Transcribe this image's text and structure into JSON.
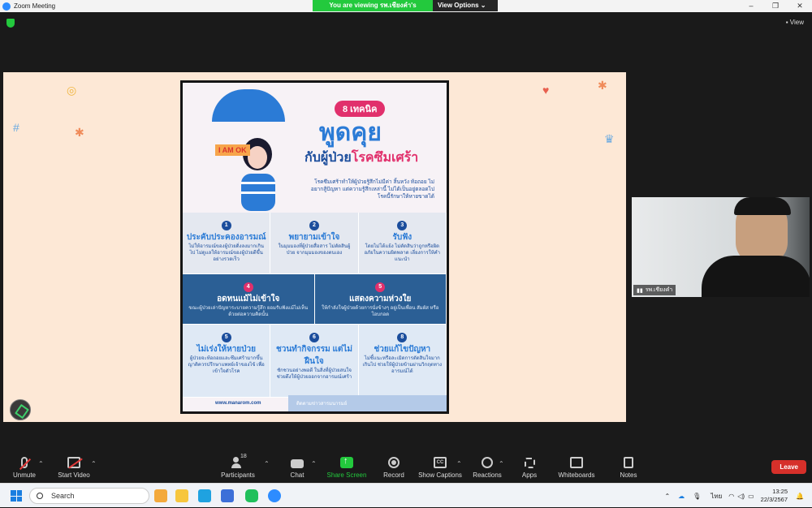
{
  "window": {
    "title": "Zoom Meeting",
    "minimize": "–",
    "restore": "❐",
    "close": "✕"
  },
  "viewing_banner": {
    "text": "You are viewing รพ.เชียงคำ's screen",
    "options_label": "View Options ⌄"
  },
  "top": {
    "view_label": "▪ View"
  },
  "poster": {
    "pill": "8 เทคนิค",
    "title": "พูดคุย",
    "subtitle_pre": "กับผู้ป่วย",
    "subtitle_pink": "โรคซึมเศร้า",
    "intro": "โรคซึมเศร้าทำให้ผู้ป่วยรู้สึกไม่มีค่า สิ้นหวัง ท้อถอย ไม่อยากสู้ปัญหา แต่ความรู้สึกเหล่านี้ ไม่ได้เป็นอยู่ตลอดไป โรคนี้รักษาให้หายขาดได้",
    "ok_sign": "I AM OK",
    "items": [
      {
        "num": "1",
        "head": "ประคับประคองอารมณ์",
        "body": "ไม่ให้อารมณ์ของผู้ป่วยดิ่งลงมากเกินไป ไม่ดูแลให้อารมณ์ของผู้ป่วยดีขึ้นอย่างรวดเร็ว"
      },
      {
        "num": "2",
        "head": "พยายามเข้าใจ",
        "body": "ในมุมมองที่ผู้ป่วยสื่อสาร ไม่ตัดสินผู้ป่วย จากมุมมองของตนเอง"
      },
      {
        "num": "3",
        "head": "รับฟัง",
        "body": "โดยไม่โต้แย้ง ไม่ตัดสินว่าถูกหรือผิด อภัยในความผิดพลาด เลี่ยงการให้คำแนะนำ"
      },
      {
        "num": "4",
        "head": "อดทนแม้ไม่เข้าใจ",
        "body": "ขณะผู้ป่วยเล่าปัญหาระบายความรู้สึก ยอมรับฟังแม้ไม่เห็นด้วยต่อความคิดนั้น"
      },
      {
        "num": "5",
        "head": "แสดงความห่วงใย",
        "body": "ให้กำลังใจผู้ป่วยด้วยการนั่งข้างๆ อยู่เป็นเพื่อน สัมผัส หรือโอบกอด"
      },
      {
        "num": "5",
        "head": "ไม่เร่งให้หายป่วย",
        "body": "ผู้ป่วยจะท้อถอยและซึมเศร้ามากขึ้น ญาติควรปรึกษาแพทย์เจ้าของไข้ เพื่อเข้าใจตัวโรค"
      },
      {
        "num": "6",
        "head": "ชวนทำกิจกรรม แต่ไม่ฝืนใจ",
        "body": "ชักชวนอย่างพอดี ในสิ่งที่ผู้ป่วยสนใจ ช่วยดึงให้ผู้ป่วยออกจากอารมณ์เศร้า"
      },
      {
        "num": "8",
        "head": "ช่วยแก้ไขปัญหา",
        "body": "ไม่ชี้แนะหรือละเมิดการตัดสินใจมากเกินไป ช่วยให้ผู้ป่วยข้ามผ่านวิกฤตทางอารมณ์ได้"
      }
    ],
    "site": "www.manarom.com",
    "follow": "ติดตามข่าวสารมนารมย์"
  },
  "participant": {
    "name": "รพ.เชียงคำ"
  },
  "toolbar": {
    "unmute": "Unmute",
    "start_video": "Start Video",
    "participants": "Participants",
    "participants_count": "18",
    "chat": "Chat",
    "share_screen": "Share Screen",
    "record": "Record",
    "show_captions": "Show Captions",
    "cc": "CC",
    "reactions": "Reactions",
    "apps": "Apps",
    "whiteboards": "Whiteboards",
    "notes": "Notes",
    "leave": "Leave"
  },
  "taskbar": {
    "search_placeholder": "Search",
    "lang": "ไทย",
    "time": "13:25",
    "date": "22/3/2567"
  },
  "colors": {
    "share_green": "#23c93d",
    "leave_red": "#d6302a",
    "zoom_blue": "#2d8cff"
  }
}
